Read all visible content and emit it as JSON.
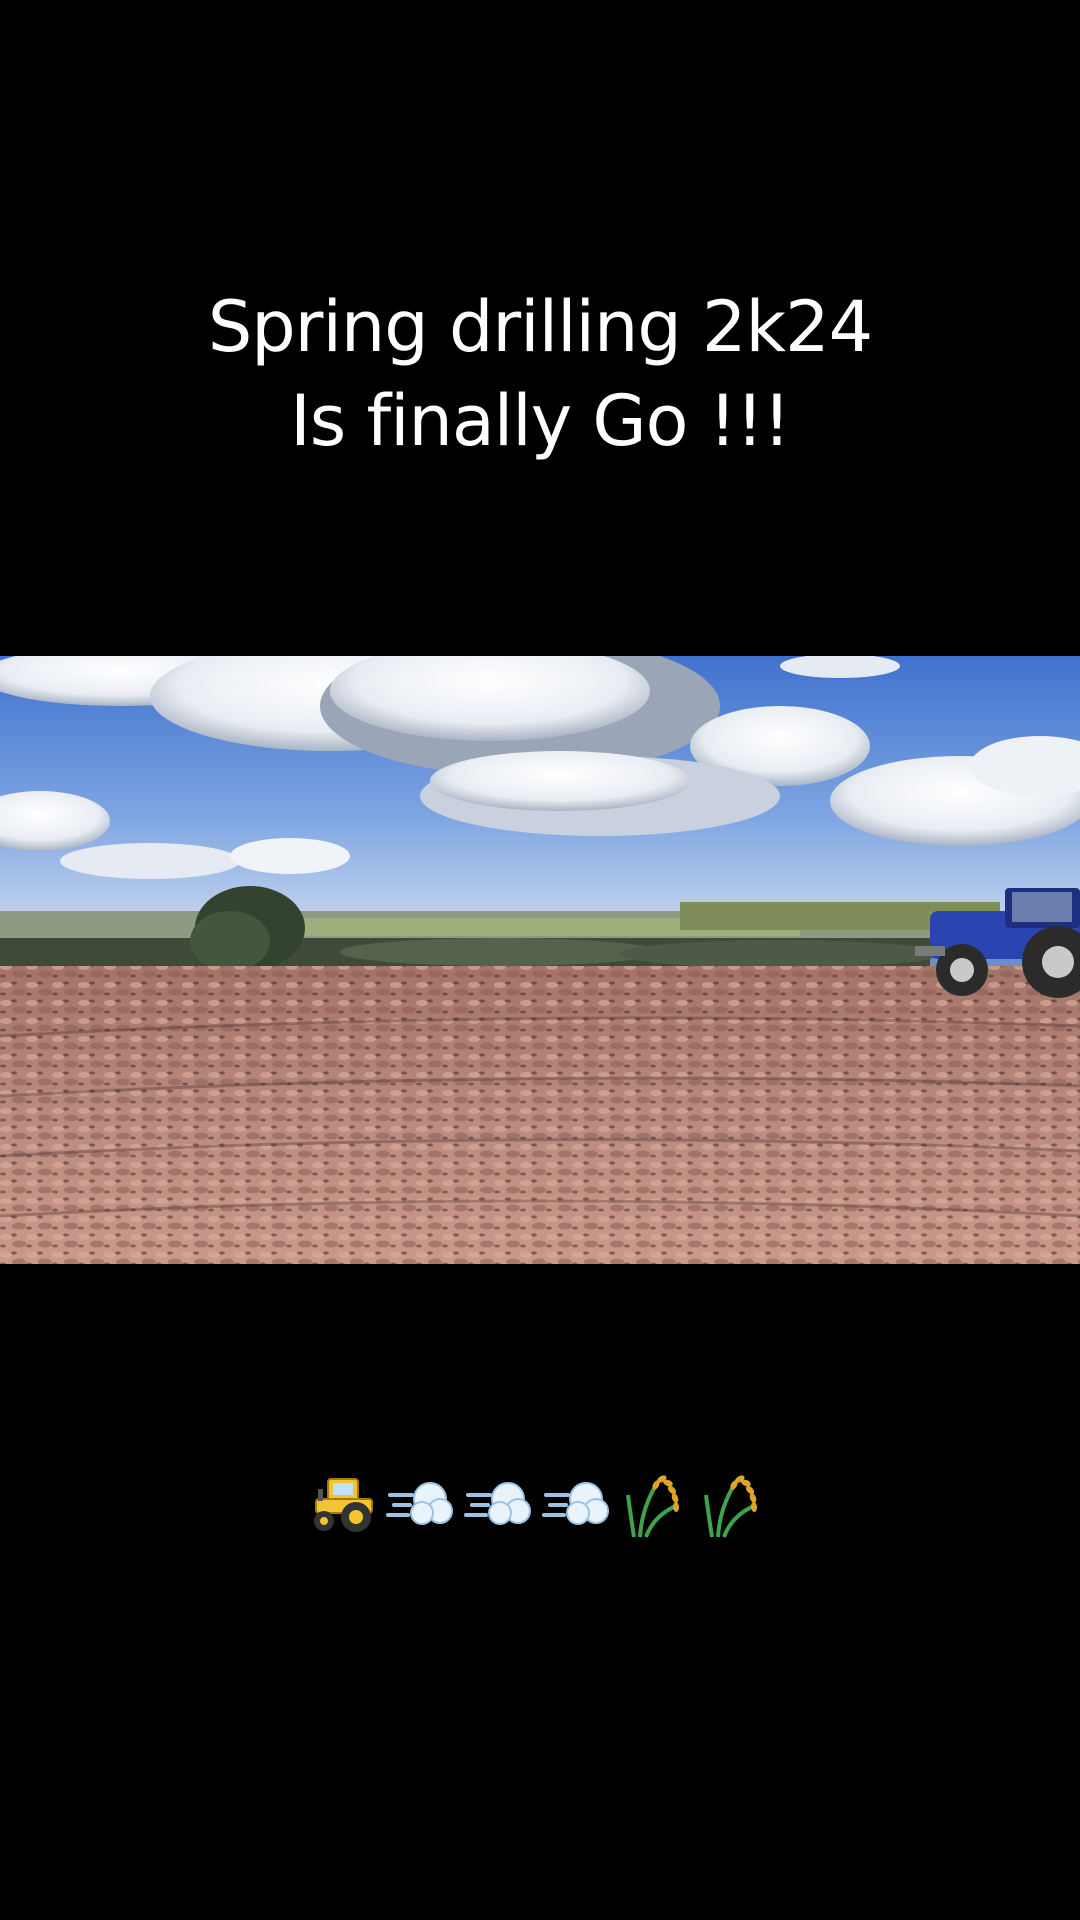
{
  "overlay": {
    "caption_line1": "Spring drilling 2k24",
    "caption_line2": "Is finally Go !!!"
  },
  "video": {
    "scene_icon": "farm-field-video-frame"
  },
  "emoji_caption": {
    "items": [
      "tractor-icon",
      "dash-cloud-icon",
      "dash-cloud-icon",
      "dash-cloud-icon",
      "rice-sheaf-icon",
      "rice-sheaf-icon"
    ]
  },
  "colors": {
    "background": "#000000",
    "caption_text": "#ffffff",
    "sky": "#5b86d6",
    "soil": "#b5857a",
    "tractor_blue": "#2a45b0"
  }
}
